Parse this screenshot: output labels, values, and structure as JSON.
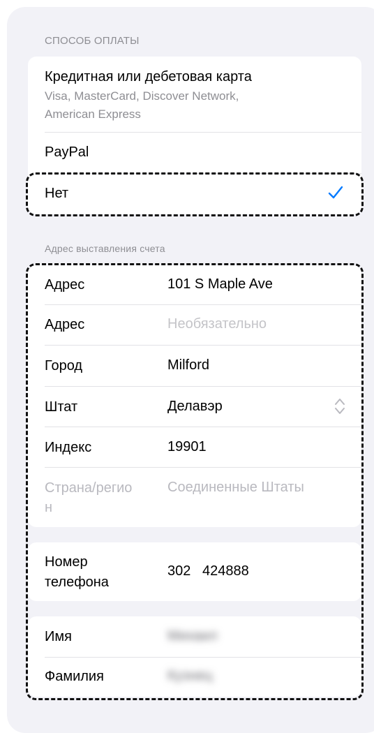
{
  "payment": {
    "header": "СПОСОБ ОПЛАТЫ",
    "options": [
      {
        "title": "Кредитная или дебетовая карта",
        "subtitle_line1": "Visa, MasterCard, Discover Network,",
        "subtitle_line2": "American Express"
      },
      {
        "title": "PayPal"
      },
      {
        "title": "Нет",
        "selected": true
      }
    ],
    "accent": "#007aff"
  },
  "billing": {
    "header": "Адрес выставления счета",
    "fields": [
      {
        "label": "Адрес",
        "value": "101 S Maple Ave"
      },
      {
        "label": "Адрес",
        "placeholder": "Необязательно"
      },
      {
        "label": "Город",
        "value": "Milford"
      },
      {
        "label": "Штат",
        "value": "Делавэр"
      },
      {
        "label": "Индекс",
        "value": "19901"
      },
      {
        "label_line1": "Страна/регио",
        "label_line2": "н",
        "value": "Соединенные Штаты",
        "disabled": true
      }
    ]
  },
  "phone": {
    "label_line1": "Номер",
    "label_line2": "телефона",
    "value": "302   424888"
  },
  "name": {
    "first_label": "Имя",
    "first_value": "Михаил",
    "last_label": "Фамилия",
    "last_value": "Кузнец"
  },
  "icons": {
    "checkmark": "checkmark-icon",
    "chevron": "chevron-up-down-icon"
  }
}
